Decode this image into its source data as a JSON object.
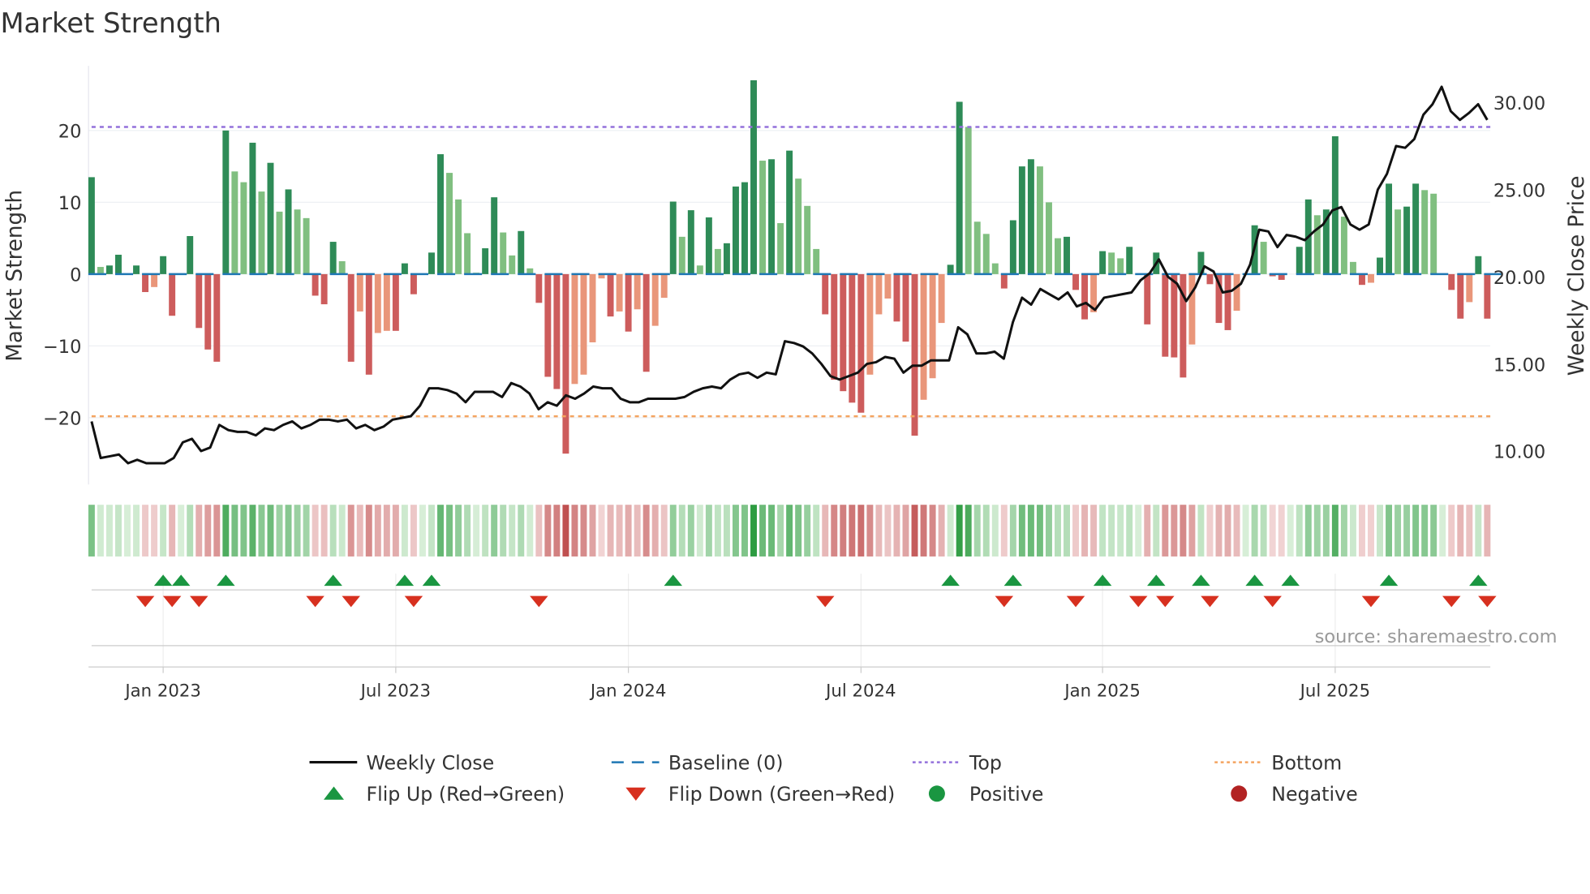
{
  "chart_data": {
    "type": "bar",
    "title": "Market Strength",
    "ylabel": "Market Strength",
    "y2label": "Weekly Close Price",
    "ylim": [
      -29.3,
      29
    ],
    "y2lim": [
      8.08,
      32.1
    ],
    "yticks": [
      20,
      10,
      0,
      -10,
      -20
    ],
    "ytick_labels": [
      "20",
      "10",
      "0",
      "−10",
      "−20"
    ],
    "y2ticks": [
      30,
      25,
      20,
      15,
      10
    ],
    "y2tick_labels": [
      "30.00",
      "25.00",
      "20.00",
      "15.00",
      "10.00"
    ],
    "xtick_week_index": [
      8,
      34,
      60,
      86,
      113,
      139
    ],
    "xtick_labels": [
      "Jan 2023",
      "Jul 2023",
      "Jan 2024",
      "Jul 2024",
      "Jan 2025",
      "Jul 2025"
    ],
    "top_level": 20.5,
    "bottom_level": -19.8,
    "baseline": 0,
    "strength": [
      13.5,
      1,
      1.2,
      2.7,
      0,
      1.2,
      -2.5,
      -1.8,
      2.5,
      -5.8,
      0,
      5.3,
      -7.5,
      -10.5,
      -12.2,
      20,
      14.3,
      12.8,
      18.3,
      11.5,
      15.5,
      8.7,
      11.8,
      9,
      7.8,
      -3,
      -4.2,
      4.5,
      1.8,
      -12.2,
      -5.2,
      -14,
      -8.2,
      -7.9,
      -7.9,
      1.5,
      -2.8,
      0,
      3,
      16.7,
      14.1,
      10.4,
      5.7,
      0.2,
      3.6,
      10.7,
      5.8,
      2.6,
      6,
      0.8,
      -4,
      -14.3,
      -16,
      -25,
      -15.3,
      -14,
      -9.5,
      -0.6,
      -5.9,
      -5.2,
      -8,
      -4.9,
      -13.6,
      -7.2,
      -3.3,
      10.1,
      5.2,
      8.9,
      1.2,
      7.9,
      3.5,
      4.3,
      12.2,
      12.8,
      27,
      15.8,
      16,
      7.1,
      17.2,
      13.3,
      9.5,
      3.5,
      -5.6,
      -14.7,
      -16.3,
      -17.9,
      -19.3,
      -14,
      -5.6,
      -3.4,
      -6.6,
      -9.4,
      -22.5,
      -17.5,
      -14.5,
      -6.8,
      1.3,
      24,
      20.5,
      7.3,
      5.6,
      1.5,
      -2,
      7.5,
      15,
      16,
      15,
      10,
      5,
      5.2,
      -2.2,
      -6.3,
      -5.3,
      3.2,
      3,
      2.2,
      3.8,
      0,
      -7,
      3,
      -11.5,
      -11.6,
      -14.4,
      -9.8,
      3.1,
      -1.4,
      -6.8,
      -7.8,
      -5.1,
      0,
      6.8,
      4.5,
      -0.3,
      -0.8,
      0,
      3.8,
      10.4,
      8.2,
      9,
      19.2,
      8,
      1.7,
      -1.5,
      -1.2,
      2.3,
      12.6,
      9,
      9.4,
      12.6,
      11.7,
      11.2,
      0,
      -2.2,
      -6.2,
      -3.9,
      2.5,
      -6.2
    ],
    "weekly_close": [
      11.7,
      9.6,
      9.7,
      9.8,
      9.3,
      9.5,
      9.3,
      9.3,
      9.3,
      9.6,
      10.5,
      10.7,
      10,
      10.2,
      11.5,
      11.2,
      11.1,
      11.1,
      10.9,
      11.3,
      11.2,
      11.5,
      11.7,
      11.3,
      11.5,
      11.8,
      11.8,
      11.7,
      11.8,
      11.3,
      11.5,
      11.2,
      11.4,
      11.8,
      11.9,
      12,
      12.6,
      13.6,
      13.6,
      13.5,
      13.3,
      12.8,
      13.4,
      13.4,
      13.4,
      13.1,
      13.9,
      13.7,
      13.3,
      12.4,
      12.8,
      12.6,
      13.2,
      13,
      13.3,
      13.7,
      13.6,
      13.6,
      13,
      12.8,
      12.8,
      13,
      13,
      13,
      13,
      13.1,
      13.4,
      13.6,
      13.7,
      13.6,
      14.1,
      14.4,
      14.5,
      14.2,
      14.5,
      14.4,
      16.3,
      16.2,
      16,
      15.6,
      15,
      14.3,
      14.1,
      14.3,
      14.5,
      15,
      15.1,
      15.4,
      15.3,
      14.5,
      14.9,
      14.9,
      15.2,
      15.2,
      15.2,
      17.1,
      16.7,
      15.6,
      15.6,
      15.7,
      15.3,
      17.4,
      18.8,
      18.4,
      19.3,
      19,
      18.7,
      19.1,
      18.3,
      18.5,
      18.1,
      18.8,
      18.9,
      19,
      19.1,
      19.8,
      20.2,
      21,
      20,
      19.6,
      18.6,
      19.4,
      20.6,
      20.3,
      19.1,
      19.2,
      19.6,
      20.7,
      22.7,
      22.6,
      21.7,
      22.4,
      22.3,
      22.1,
      22.6,
      23,
      23.8,
      24,
      23,
      22.7,
      23,
      25,
      25.9,
      27.5,
      27.4,
      27.9,
      29.3,
      29.9,
      30.9,
      29.5,
      29,
      29.4,
      29.9,
      29
    ],
    "flip_up_week_index": [
      8,
      10,
      15,
      27,
      35,
      38,
      65,
      96,
      103,
      113,
      119,
      124,
      130,
      134,
      145,
      155
    ],
    "flip_down_week_index": [
      6,
      9,
      12,
      25,
      29,
      36,
      50,
      82,
      102,
      110,
      117,
      120,
      125,
      132,
      143,
      152,
      156
    ],
    "legend": [
      {
        "label": "Weekly Close",
        "marker": "line",
        "color": "#111111"
      },
      {
        "label": "Baseline (0)",
        "marker": "dash",
        "color": "#1f77b4"
      },
      {
        "label": "Top",
        "marker": "dot",
        "color": "#9370db"
      },
      {
        "label": "Bottom",
        "marker": "dot",
        "color": "#f4a460"
      },
      {
        "label": "Flip Up (Red→Green)",
        "marker": "triangle-up",
        "color": "#1a9641"
      },
      {
        "label": "Flip Down (Green→Red)",
        "marker": "triangle-down",
        "color": "#d7301f"
      },
      {
        "label": "Positive",
        "marker": "circle",
        "color": "#1a9641"
      },
      {
        "label": "Negative",
        "marker": "circle",
        "color": "#b22222"
      }
    ],
    "source": "source: sharemaestro.com",
    "colors": {
      "pos_up": "#2e8b57",
      "pos_down": "#80bf80",
      "neg_down": "#cd5c5c",
      "neg_up": "#e9967a",
      "baseline": "#1f77b4",
      "top": "#9370db",
      "bottom": "#f4a460",
      "price": "#111111"
    }
  }
}
